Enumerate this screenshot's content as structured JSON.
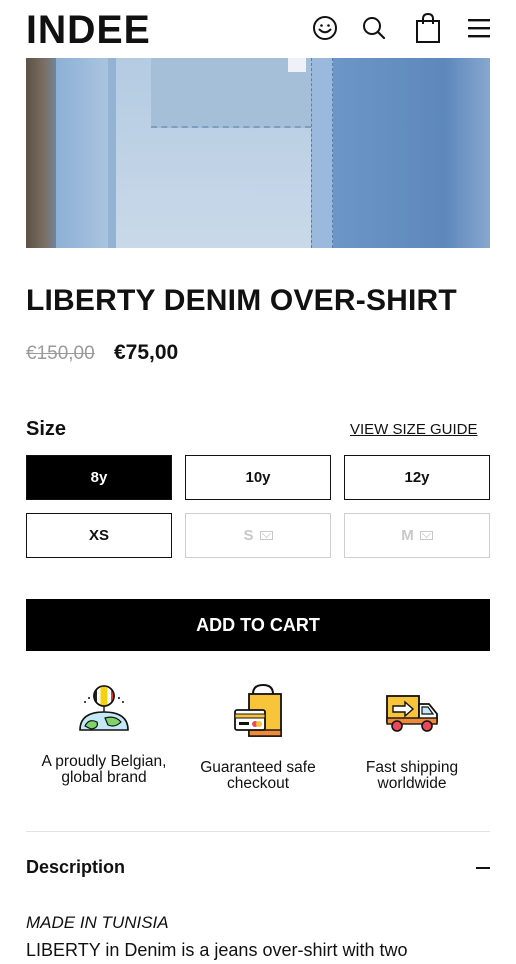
{
  "header": {
    "logo": "INDEE",
    "icons": [
      "smiley-account-icon",
      "search-icon",
      "shopping-bag-icon",
      "menu-icon"
    ]
  },
  "product": {
    "title": "LIBERTY DENIM OVER-SHIRT",
    "old_price": "€150,00",
    "price": "€75,00"
  },
  "size": {
    "label": "Size",
    "guide_link": "VIEW SIZE GUIDE",
    "options": [
      {
        "label": "8y",
        "state": "selected"
      },
      {
        "label": "10y",
        "state": "available"
      },
      {
        "label": "12y",
        "state": "available"
      },
      {
        "label": "XS",
        "state": "available"
      },
      {
        "label": "S",
        "state": "sold-out"
      },
      {
        "label": "M",
        "state": "sold-out"
      }
    ]
  },
  "cart": {
    "label": "ADD TO CART"
  },
  "features": [
    {
      "icon": "globe-belgium-icon",
      "text": "A proudly Belgian, global brand"
    },
    {
      "icon": "secure-shopping-bag-card-icon",
      "text": "Guaranteed safe checkout"
    },
    {
      "icon": "delivery-truck-icon",
      "text": "Fast shipping worldwide"
    }
  ],
  "description": {
    "title": "Description",
    "made_in": "MADE IN TUNISIA",
    "text": "LIBERTY in Denim is a jeans over-shirt with two"
  },
  "colors": {
    "primary": "#000000",
    "disabled": "#c8c8c8",
    "strike": "#9a9a9a"
  }
}
